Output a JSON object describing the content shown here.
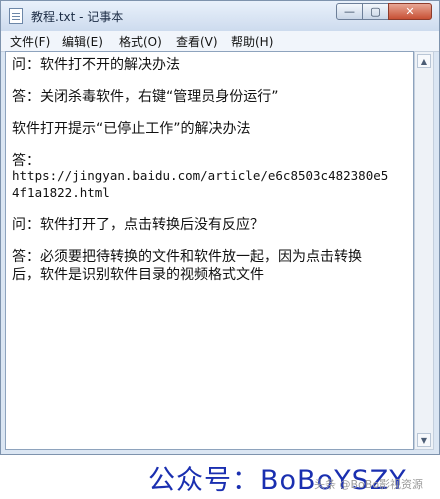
{
  "window": {
    "title": "教程.txt - 记事本",
    "controls": {
      "minimize": "—",
      "maximize": "▢",
      "close": "✕"
    }
  },
  "menu": {
    "items": [
      "文件(F)",
      "编辑(E)",
      "格式(O)",
      "查看(V)",
      "帮助(H)"
    ]
  },
  "document": {
    "lines": [
      "问：软件打不开的解决办法",
      "答：关闭杀毒软件，右键“管理员身份运行”",
      "软件打开提示“已停止工作”的解决办法",
      "答：",
      "https://jingyan.baidu.com/article/e6c8503c482380e5",
      "4f1a1822.html",
      "问：软件打开了，点击转换后没有反应？",
      "答：必须要把待转换的文件和软件放一起，因为点击转换",
      "后，软件是识别软件目录的视频格式文件"
    ]
  },
  "scrollbar": {
    "up": "▲",
    "down": "▼"
  },
  "footer": {
    "text": "公众号：BoBoYSZY",
    "watermark": "头条 @BoBo影视资源"
  },
  "colors": {
    "footer_text": "#1a2fb0",
    "close_button": "#c75034",
    "titlebar": "#cddbee"
  }
}
